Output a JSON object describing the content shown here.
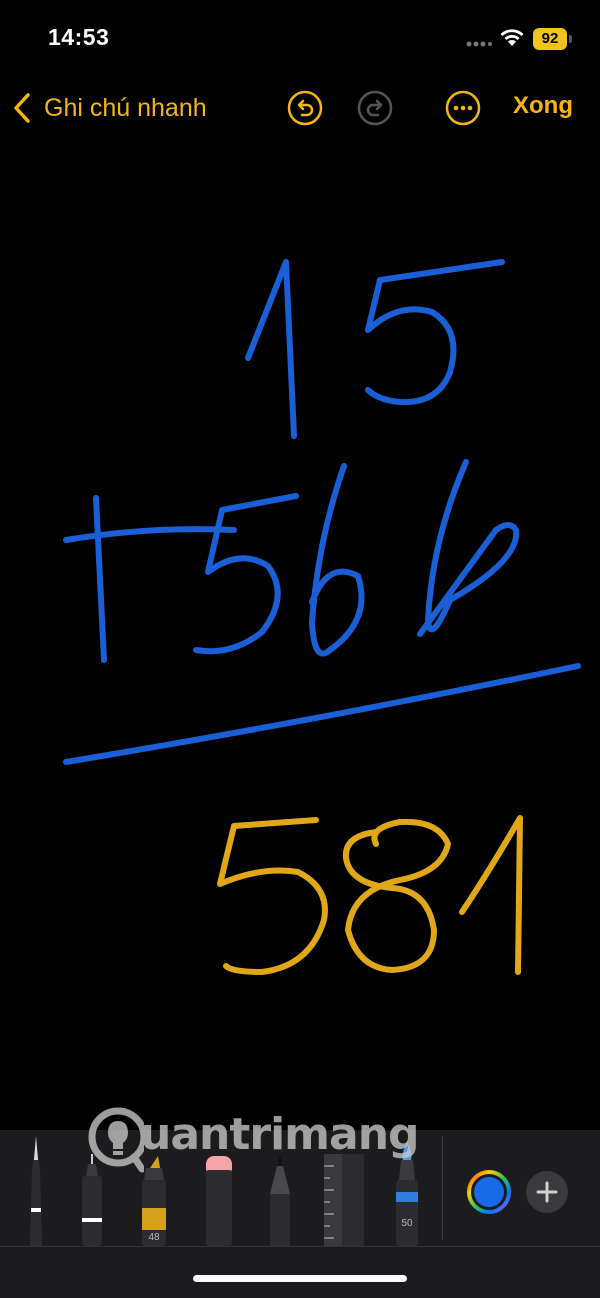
{
  "status_bar": {
    "time": "14:53",
    "battery_level": "92",
    "signal_icon": "signal-icon",
    "wifi_icon": "wifi-icon"
  },
  "nav": {
    "back_label": "Ghi chú nhanh",
    "undo_icon": "undo-icon",
    "redo_icon": "redo-icon",
    "more_icon": "more-icon",
    "done_label": "Xong"
  },
  "drawing": {
    "lines": [
      {
        "text": "15",
        "color": "#1a5fd6"
      },
      {
        "text": "+566",
        "color": "#1a5fd6"
      },
      {
        "text": "581",
        "color": "#e0a818"
      }
    ],
    "underline_color": "#1a5fd6"
  },
  "tools": {
    "items": [
      {
        "name": "pen",
        "icon": "pen-icon"
      },
      {
        "name": "fineliner",
        "icon": "fineliner-icon"
      },
      {
        "name": "marker",
        "icon": "marker-icon",
        "size_label": "48",
        "color": "#d4a11a"
      },
      {
        "name": "eraser",
        "icon": "eraser-icon"
      },
      {
        "name": "pencil",
        "icon": "pencil-icon"
      },
      {
        "name": "ruler",
        "icon": "ruler-icon"
      },
      {
        "name": "watercolor",
        "icon": "watercolor-icon",
        "size_label": "50",
        "color": "#2f7ee0"
      }
    ],
    "selected_color": "#1a6ae8",
    "add_icon": "plus-icon"
  },
  "watermark": {
    "text": "uantrimang"
  },
  "colors": {
    "accent": "#f5b614",
    "background": "#000000",
    "palette_background": "#1c1c1e"
  }
}
